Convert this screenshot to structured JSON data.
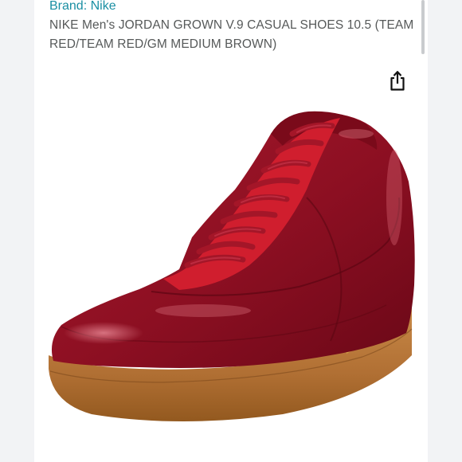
{
  "product": {
    "brand_line": "Brand: Nike",
    "title": "NIKE Men's JORDAN GROWN V.9 CASUAL SHOES 10.5 (TEAM RED/TEAM RED/GM MEDIUM BROWN)"
  },
  "icons": {
    "share": "share-icon"
  },
  "colors": {
    "brand_link": "#1a8fa3",
    "title_text": "#565959",
    "shoe_upper": "#8e1020",
    "shoe_sole": "#b8783d"
  }
}
